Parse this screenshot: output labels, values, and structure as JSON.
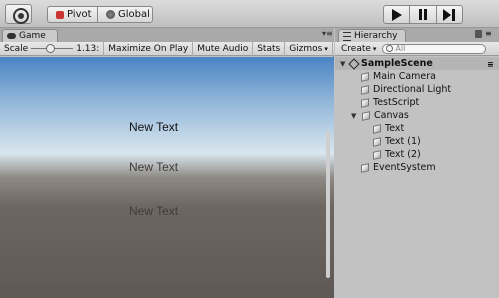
{
  "toolbar": {
    "pivot_label": "Pivot",
    "global_label": "Global"
  },
  "game": {
    "tab_label": "Game",
    "scale_label": "Scale",
    "scale_value": "1.13:",
    "scale_slider_fraction": 0.45,
    "maximize_label": "Maximize On Play",
    "mute_label": "Mute Audio",
    "stats_label": "Stats",
    "gizmos_label": "Gizmos",
    "texts": [
      "New Text",
      "New Text",
      "New Text"
    ]
  },
  "hierarchy": {
    "tab_label": "Hierarchy",
    "create_label": "Create",
    "search_placeholder": "All",
    "scene_name": "SampleScene",
    "items": [
      {
        "label": "Main Camera"
      },
      {
        "label": "Directional Light"
      },
      {
        "label": "TestScript"
      },
      {
        "label": "Canvas"
      },
      {
        "label": "Text"
      },
      {
        "label": "Text (1)"
      },
      {
        "label": "Text (2)"
      },
      {
        "label": "EventSystem"
      }
    ]
  },
  "colors": {
    "panel_bg": "#c2c2c2",
    "sky_top": "#4a84c4",
    "horizon": "#d9e6ef",
    "ground": "#6d6661"
  }
}
